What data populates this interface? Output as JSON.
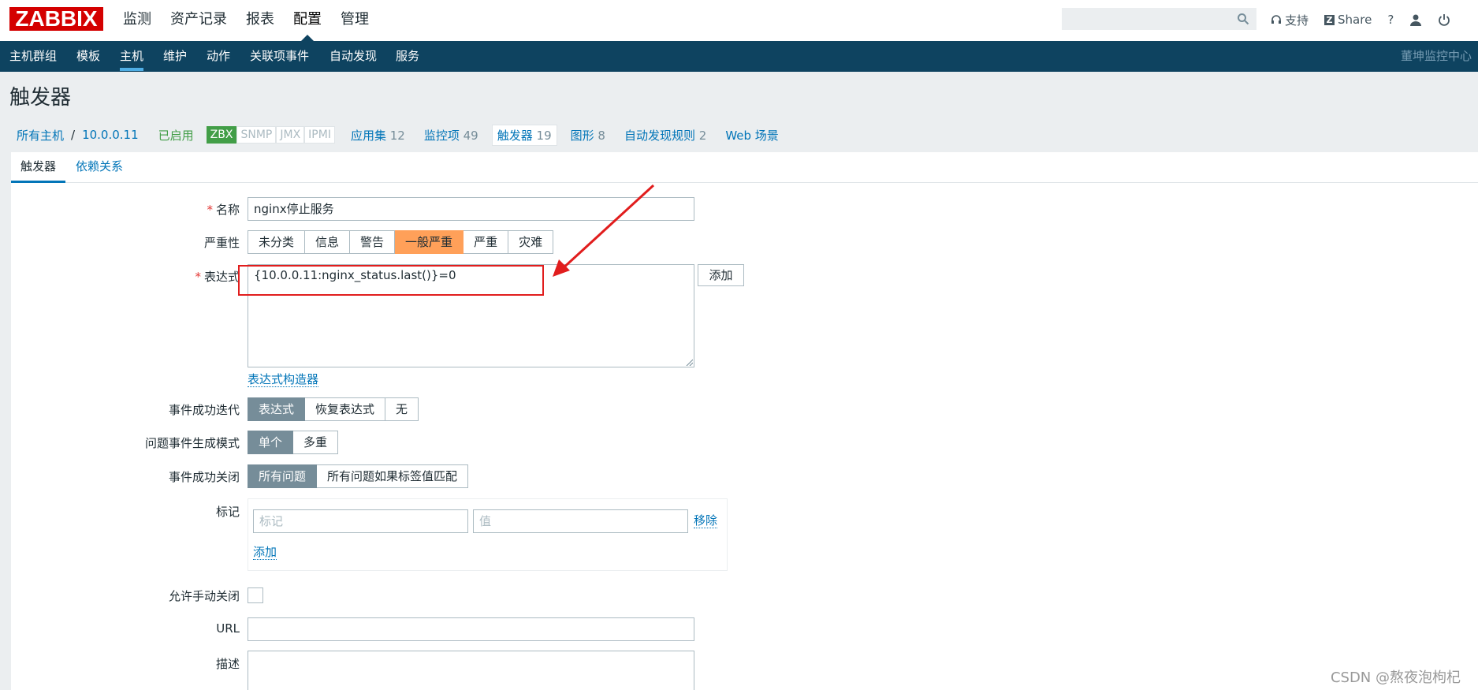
{
  "app": {
    "logo": "ZABBIX"
  },
  "main_menu": [
    "监测",
    "资产记录",
    "报表",
    "配置",
    "管理"
  ],
  "main_menu_active": "配置",
  "top_right": {
    "support": "支持",
    "share": "Share",
    "help": "?"
  },
  "sub_menu": [
    "主机群组",
    "模板",
    "主机",
    "维护",
    "动作",
    "关联项事件",
    "自动发现",
    "服务"
  ],
  "sub_menu_active": "主机",
  "org_label": "董坤监控中心",
  "page_title": "触发器",
  "breadcrumb": {
    "all_hosts": "所有主机",
    "separator": "/",
    "host": "10.0.0.11",
    "status": "已启用",
    "availability": [
      "ZBX",
      "SNMP",
      "JMX",
      "IPMI"
    ],
    "items": [
      {
        "label": "应用集",
        "count": "12"
      },
      {
        "label": "监控项",
        "count": "49"
      },
      {
        "label": "触发器",
        "count": "19"
      },
      {
        "label": "图形",
        "count": "8"
      },
      {
        "label": "自动发现规则",
        "count": "2"
      },
      {
        "label": "Web 场景",
        "count": ""
      }
    ]
  },
  "tabs": [
    "触发器",
    "依赖关系"
  ],
  "form": {
    "name_label": "名称",
    "name_value": "nginx停止服务",
    "severity_label": "严重性",
    "severity_options": [
      "未分类",
      "信息",
      "警告",
      "一般严重",
      "严重",
      "灾难"
    ],
    "severity_selected": "一般严重",
    "expression_label": "表达式",
    "expression_value": "{10.0.0.11:nginx_status.last()}=0",
    "add_button": "添加",
    "expression_builder": "表达式构造器",
    "ok_event_label": "事件成功迭代",
    "ok_event_options": [
      "表达式",
      "恢复表达式",
      "无"
    ],
    "ok_event_selected": "表达式",
    "problem_mode_label": "问题事件生成模式",
    "problem_mode_options": [
      "单个",
      "多重"
    ],
    "problem_mode_selected": "单个",
    "ok_close_label": "事件成功关闭",
    "ok_close_options": [
      "所有问题",
      "所有问题如果标签值匹配"
    ],
    "ok_close_selected": "所有问题",
    "tags_label": "标记",
    "tag_placeholder": "标记",
    "value_placeholder": "值",
    "remove_link": "移除",
    "add_tag_link": "添加",
    "manual_close_label": "允许手动关闭",
    "manual_close_checked": false,
    "url_label": "URL",
    "url_value": "",
    "description_label": "描述"
  },
  "watermark": "CSDN @熬夜泡枸杞",
  "colors": {
    "brand": "#d40000",
    "nav": "#0e4360",
    "link": "#0275b8",
    "severity_average": "#ffa059",
    "annotation": "#e11d1d"
  }
}
